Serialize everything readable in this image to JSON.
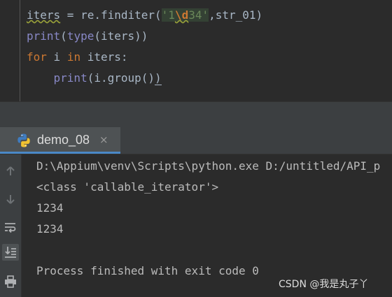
{
  "editor": {
    "lines": [
      {
        "var": "iters",
        "eq": " = re.finditer(",
        "str_open": "'1",
        "esc": "\\d",
        "str_close": "34'",
        "tail": ",str_01)"
      },
      {
        "print": "print",
        "p1": "(",
        "type": "type",
        "p2": "(iters))"
      },
      {
        "for": "for",
        "mid1": " i ",
        "in": "in",
        "mid2": " iters:"
      },
      {
        "indent": "    ",
        "print": "print",
        "rest": "(i.group()",
        "close": ")"
      }
    ]
  },
  "run_panel": {
    "tab_label": "demo_08",
    "tab_close": "×",
    "tools": [
      "up-arrow-icon",
      "down-arrow-icon",
      "soft-wrap-icon",
      "scroll-to-end-icon",
      "print-icon"
    ]
  },
  "console": {
    "lines": [
      "D:\\Appium\\venv\\Scripts\\python.exe D:/untitled/API_p",
      "<class 'callable_iterator'>",
      "1234",
      "1234",
      "",
      "Process finished with exit code 0"
    ]
  },
  "watermark": "CSDN @我是丸子丫",
  "colors": {
    "background": "#2b2b2b",
    "keyword": "#cc7832",
    "builtin": "#8888c6",
    "string": "#6a8759",
    "tab_accent": "#4a88c7"
  }
}
